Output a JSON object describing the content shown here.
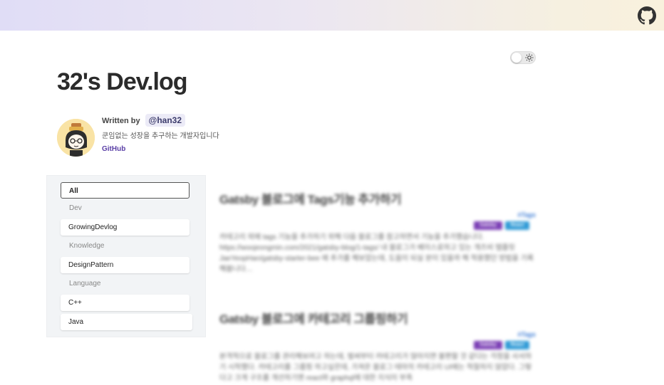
{
  "header": {
    "github_icon": "github-icon"
  },
  "theme_toggle": {
    "icon": "sun-icon"
  },
  "blog": {
    "title": "32's Dev.log"
  },
  "author": {
    "written_by_label": "Written by",
    "handle": "@han32",
    "bio": "쿤임없는 성장을 추구하는 개발자입니다",
    "github_label": "GitHub",
    "avatar_icon": "avatar-illustration"
  },
  "sidebar": {
    "all_label": "All",
    "groups": [
      {
        "heading": "Dev",
        "items": [
          "GrowingDevlog"
        ]
      },
      {
        "heading": "Knowledge",
        "items": [
          "DesignPattern"
        ]
      },
      {
        "heading": "Language",
        "items": [
          "C++",
          "Java"
        ]
      }
    ]
  },
  "posts": [
    {
      "title": "Gatsby 블로그에 Tags기능 추가하기",
      "tags_label": "#Tags",
      "tags": [
        "Gatsby",
        "React"
      ],
      "excerpt": "카테고리 외에 tags 기능을 추가하기 위해 다음 블로그를 참고하면서 기능을 추가했습니다. https://woojeongmin.com/2021/gatsby-blog/1-tags/ 내 블로그가 베이스로하고 있는 개츠비 템플릿 JaeYeopHan/gatsby-starter-bee 에 추가를 해보았는데, 도움이 되실 분이 있을까 해 적용했던 방법을 기록해봅니다…"
    },
    {
      "title": "Gatsby 블로그에 카테고리 그룹핑하기",
      "tags_label": "#Tags",
      "tags": [
        "Gatsby",
        "React"
      ],
      "excerpt": "본격적으로 블로그를 관리해보려고 하는데, 벌써부터 카테고리가 많아지면 불편할 것 같다는 걱정을 사서하기 시작했다. 카테고리를 그룹핑 하고싶은데, 가져온 블로그 테마의 카테고리 UI에는 적절하지 않았다. 그렇다고 크게 구조를 개선하기엔 react와 graphql에 대한 지식이 부족"
    }
  ],
  "colors": {
    "accent": "#5a3fa6",
    "tag_purple": "#7b3fb5",
    "tag_blue": "#2f9ad6"
  }
}
